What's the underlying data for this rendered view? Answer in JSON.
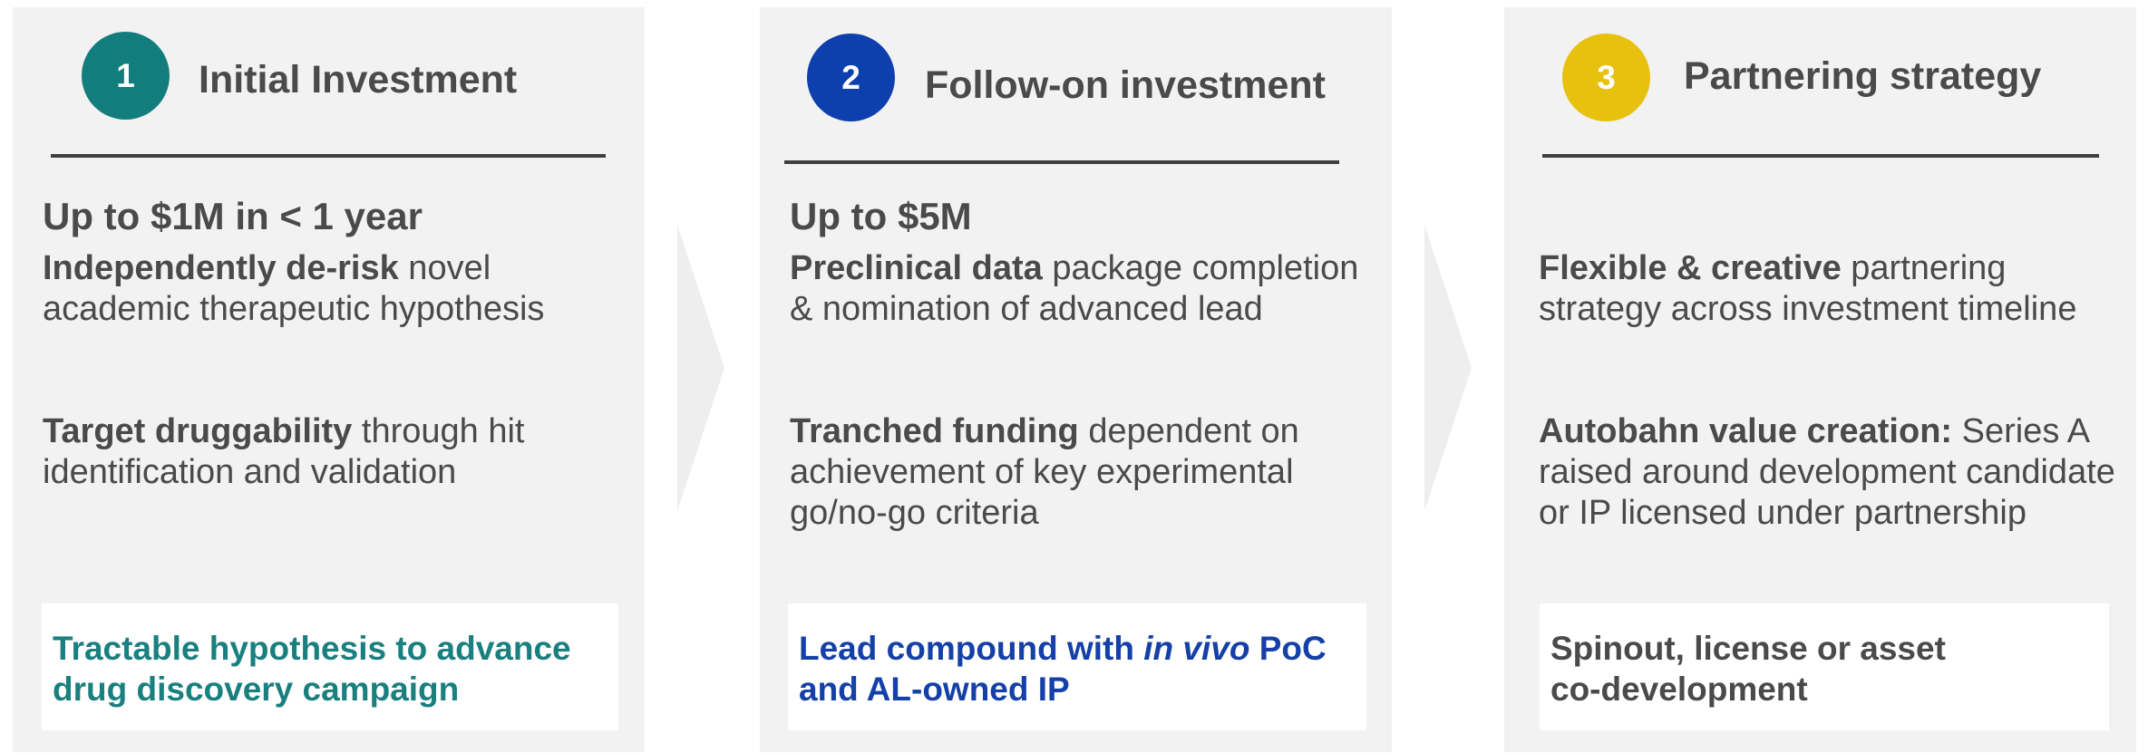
{
  "colors": {
    "panel_bg": "#f2f2f2",
    "stage1_accent": "#137d7e",
    "stage2_accent": "#0e3fae",
    "stage3_accent": "#e8c10f",
    "text": "#4a4a4a",
    "chevron": "#eeeeee"
  },
  "stages": [
    {
      "number": "1",
      "title": "Initial Investment",
      "amount": "Up to $1M in < 1 year",
      "point1_bold": "Independently de-risk",
      "point1_rest": " novel academic therapeutic hypothesis",
      "point2_bold": "Target druggability",
      "point2_rest": " through hit identification and validation",
      "outcome_line1": "Tractable hypothesis to advance",
      "outcome_line2": "drug discovery campaign"
    },
    {
      "number": "2",
      "title": "Follow-on investment",
      "amount": "Up to $5M",
      "point1_bold": "Preclinical data",
      "point1_rest": " package completion & nomination of advanced lead",
      "point2_bold": "Tranched funding",
      "point2_rest": " dependent on achievement of key experimental go/no-go criteria",
      "outcome_pre": "Lead compound with ",
      "outcome_italic": "in vivo",
      "outcome_post": " PoC",
      "outcome_line2": "and AL-owned IP"
    },
    {
      "number": "3",
      "title": "Partnering strategy",
      "amount": "",
      "point1_bold": "Flexible & creative",
      "point1_rest": " partnering strategy across investment timeline",
      "point2_bold": "Autobahn value creation:",
      "point2_rest": " Series A raised around development candidate or IP licensed under partnership",
      "outcome_line1": "Spinout, license or asset",
      "outcome_line2": "co-development"
    }
  ]
}
